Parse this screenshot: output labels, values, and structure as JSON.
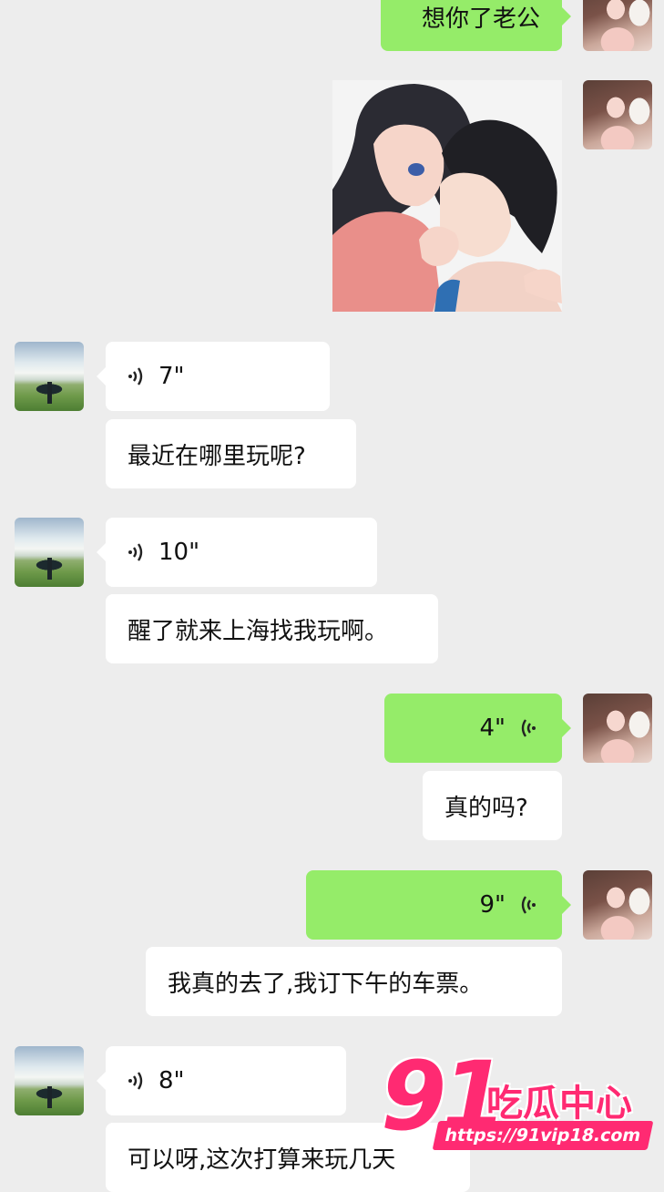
{
  "messages": {
    "m1": {
      "text": "想你了老公"
    },
    "m3": {
      "duration": "7\""
    },
    "m4": {
      "text": "最近在哪里玩呢?"
    },
    "m5": {
      "duration": "10\""
    },
    "m6": {
      "text": "醒了就来上海找我玩啊。"
    },
    "m7": {
      "duration": "4\""
    },
    "m8": {
      "text": "真的吗?"
    },
    "m9": {
      "duration": "9\""
    },
    "m10": {
      "text": "我真的去了,我订下午的车票。"
    },
    "m11": {
      "duration": "8\""
    },
    "m12": {
      "text": "可以呀,这次打算来玩几天"
    }
  },
  "watermark": {
    "number": "91",
    "brand": "吃瓜中心",
    "url": "https://91vip18.com"
  },
  "colors": {
    "background": "#ededed",
    "outgoing_bubble": "#95ec69",
    "incoming_bubble": "#ffffff",
    "watermark": "#ff2a72"
  },
  "icons": {
    "voice_in": "voice-wave-icon",
    "voice_out": "voice-wave-icon"
  }
}
